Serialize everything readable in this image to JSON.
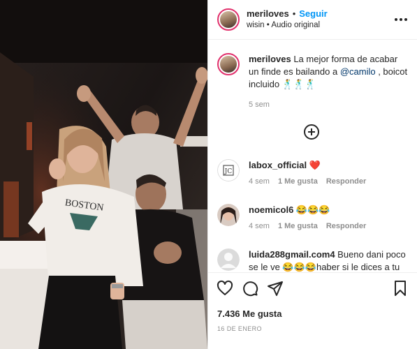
{
  "post": {
    "username": "meriloves",
    "follow_label": "Seguir",
    "audio_line": "wisin • Audio original",
    "separator": "•"
  },
  "caption": {
    "username": "meriloves",
    "text_before": " La mejor forma de acabar un finde es bailando a ",
    "mention": "@camilo",
    "text_after": " , boicot incluido 🕺🕺🕺",
    "age": "5 sem"
  },
  "comments": [
    {
      "username": "labox_official",
      "text": " ❤️",
      "age": "4 sem",
      "likes": "1 Me gusta",
      "reply": "Responder"
    },
    {
      "username": "noemicol6",
      "text": " 😂😂😂",
      "age": "4 sem",
      "likes": "1 Me gusta",
      "reply": "Responder"
    },
    {
      "username": "luida288gmail.com4",
      "text": " Bueno dani poco se le ve 😂😂😂haber si le dices a tu"
    }
  ],
  "stats": {
    "likes_label": "7.436 Me gusta",
    "date": "16 DE ENERO"
  },
  "colors": {
    "accent": "#0095f6",
    "text": "#262626",
    "muted": "#8e8e8e",
    "story_ring": "#e1306c"
  },
  "icons": [
    "more-options-icon",
    "add-comment-icon",
    "heart-icon",
    "comment-icon",
    "share-icon",
    "bookmark-icon"
  ]
}
